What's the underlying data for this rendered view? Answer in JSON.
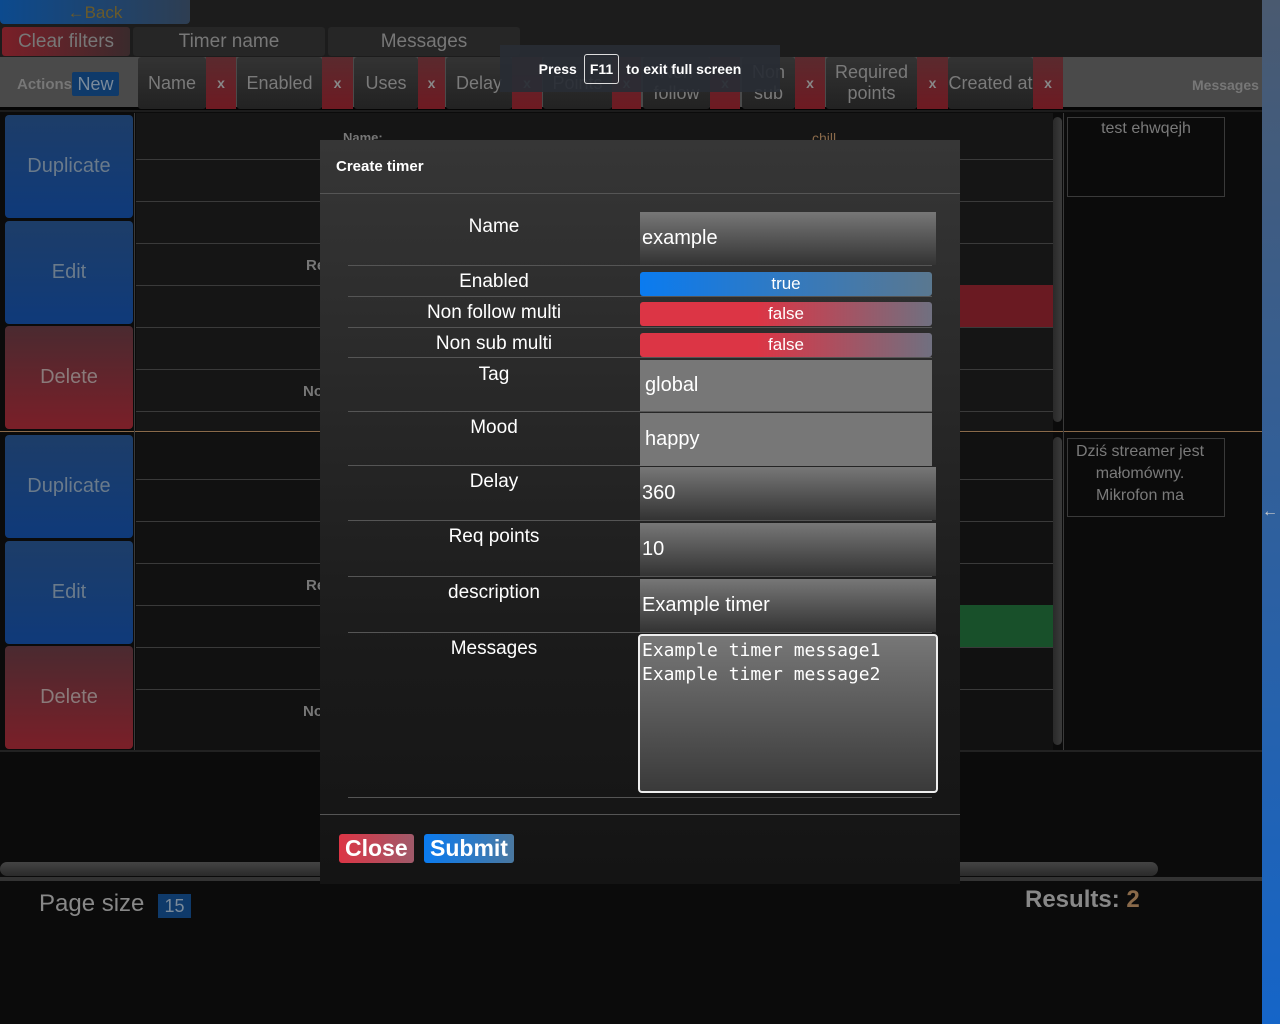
{
  "nav": {
    "back": "←Back"
  },
  "filters": {
    "clear": "Clear filters",
    "timer_name": "Timer name",
    "messages": "Messages"
  },
  "header": {
    "actions": "Actions",
    "new": "New",
    "remove": "x",
    "columns": [
      "Name",
      "Enabled",
      "Uses",
      "Delay",
      "Points",
      "Non follow",
      "Non sub",
      "Required points",
      "Created at"
    ],
    "messages": "Messages"
  },
  "fullscreen": {
    "press": "Press",
    "key": "F11",
    "rest": "to exit full screen"
  },
  "rows": [
    {
      "duplicate": "Duplicate",
      "edit": "Edit",
      "delete": "Delete",
      "name_label": "Name:",
      "mood": "chill",
      "partial1": "Re",
      "partial2": "No",
      "message": "test ehwqejh",
      "status_color": "#6a1a22"
    },
    {
      "duplicate": "Duplicate",
      "edit": "Edit",
      "delete": "Delete",
      "partial1": "Re",
      "partial2": "No",
      "message": "Dziś streamer jest małomówny. Mikrofon ma",
      "status_color": "#18502a"
    }
  ],
  "modal": {
    "title": "Create timer",
    "fields": {
      "name": {
        "label": "Name",
        "value": "example"
      },
      "enabled": {
        "label": "Enabled",
        "value": "true"
      },
      "non_follow": {
        "label": "Non follow multi",
        "value": "false"
      },
      "non_sub": {
        "label": "Non sub multi",
        "value": "false"
      },
      "tag": {
        "label": "Tag",
        "value": "global"
      },
      "mood": {
        "label": "Mood",
        "value": "happy"
      },
      "delay": {
        "label": "Delay",
        "value": "360"
      },
      "req_points": {
        "label": "Req points",
        "value": "10"
      },
      "description": {
        "label": "description",
        "value": "Example timer"
      },
      "messages": {
        "label": "Messages",
        "value": "Example timer message1\nExample timer message2"
      }
    },
    "close": "Close",
    "submit": "Submit"
  },
  "footer": {
    "page_size_label": "Page size",
    "page_size": "15",
    "results_label": "Results:",
    "results": "2"
  }
}
